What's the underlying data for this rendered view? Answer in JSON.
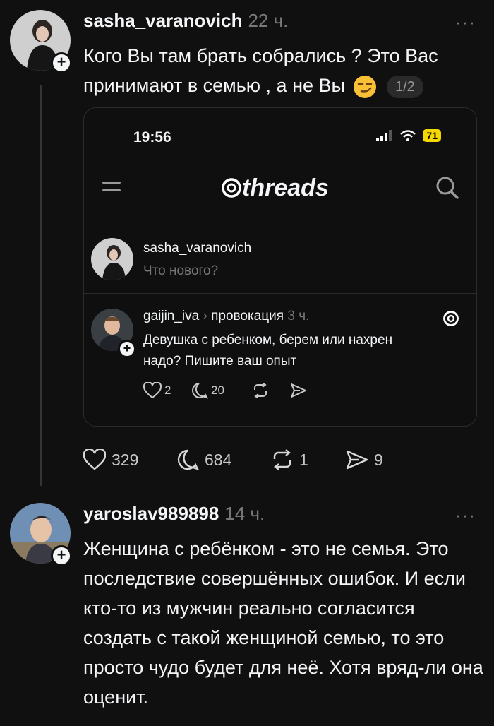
{
  "post1": {
    "username": "sasha_varanovich",
    "time": "22 ч.",
    "more": "···",
    "text_line1": "Кого Вы там брать собрались ? Это Вас",
    "text_line2": "принимают в семью , а не Вы",
    "page_indicator": "1/2",
    "embed": {
      "clock": "19:56",
      "battery": "71",
      "brand": "threads",
      "composer_username": "sasha_varanovich",
      "composer_placeholder": "Что нового?",
      "inner_post": {
        "username": "gaijin_iva",
        "separator": "›",
        "topic": "провокация",
        "time": "3 ч.",
        "text_line1": "Девушка с ребенком, берем или нахрен",
        "text_line2": "надо? Пишите ваш опыт",
        "likes": "2",
        "replies": "20"
      }
    },
    "likes": "329",
    "replies": "684",
    "reposts": "1",
    "shares": "9"
  },
  "post2": {
    "username": "yaroslav989898",
    "time": "14 ч.",
    "more": "···",
    "text": "Женщина с ребёнком - это не семья. Это последствие совершённых ошибок. И если кто-то из мужчин реально согласится создать с такой женщиной семью, то это просто чудо будет для неё. Хотя вряд-ли она оценит."
  },
  "icons": {
    "plus": "+",
    "like": "heart-icon",
    "reply": "comment-icon",
    "repost": "repost-icon",
    "share": "share-icon"
  }
}
